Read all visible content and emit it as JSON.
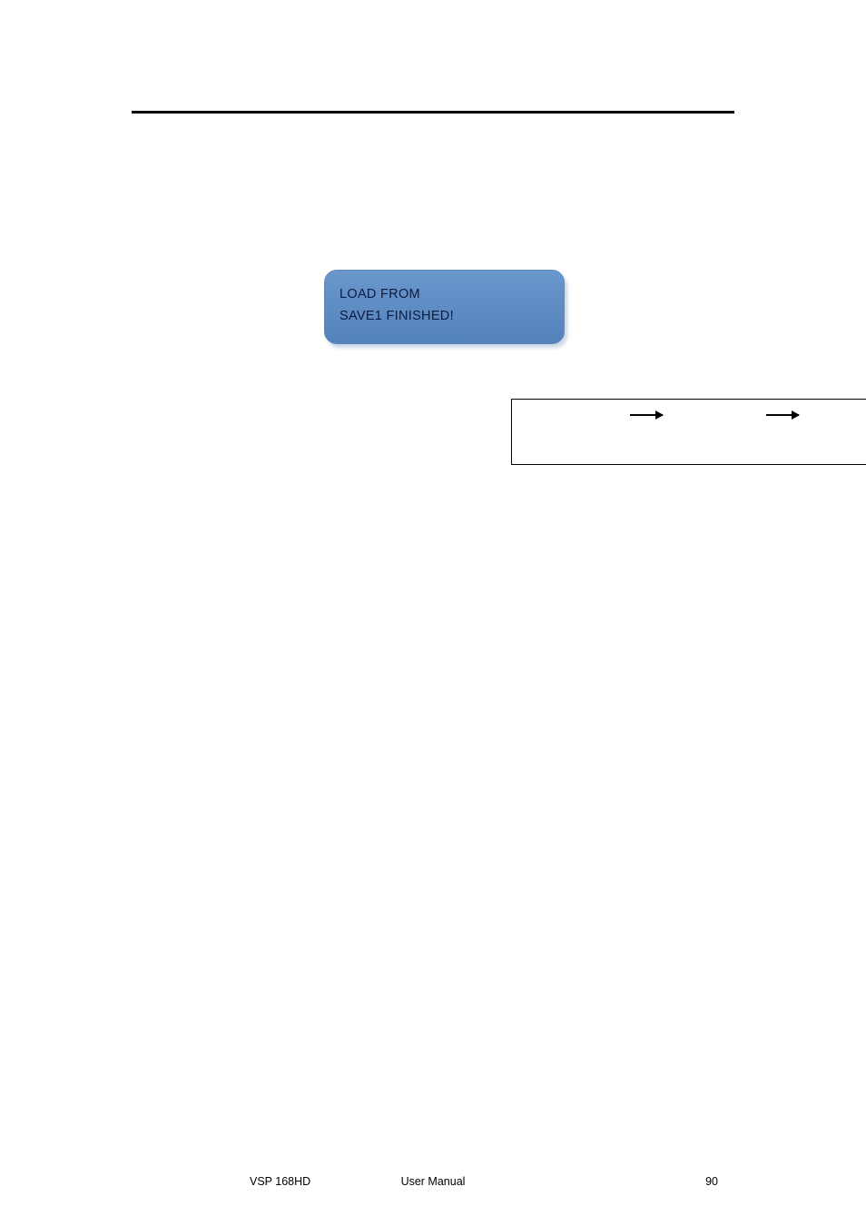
{
  "lcd": {
    "line1": "LOAD FROM",
    "line2": "SAVE1 FINISHED!"
  },
  "footer": {
    "left": "VSP 168HD",
    "center": "User Manual",
    "page": "90"
  }
}
